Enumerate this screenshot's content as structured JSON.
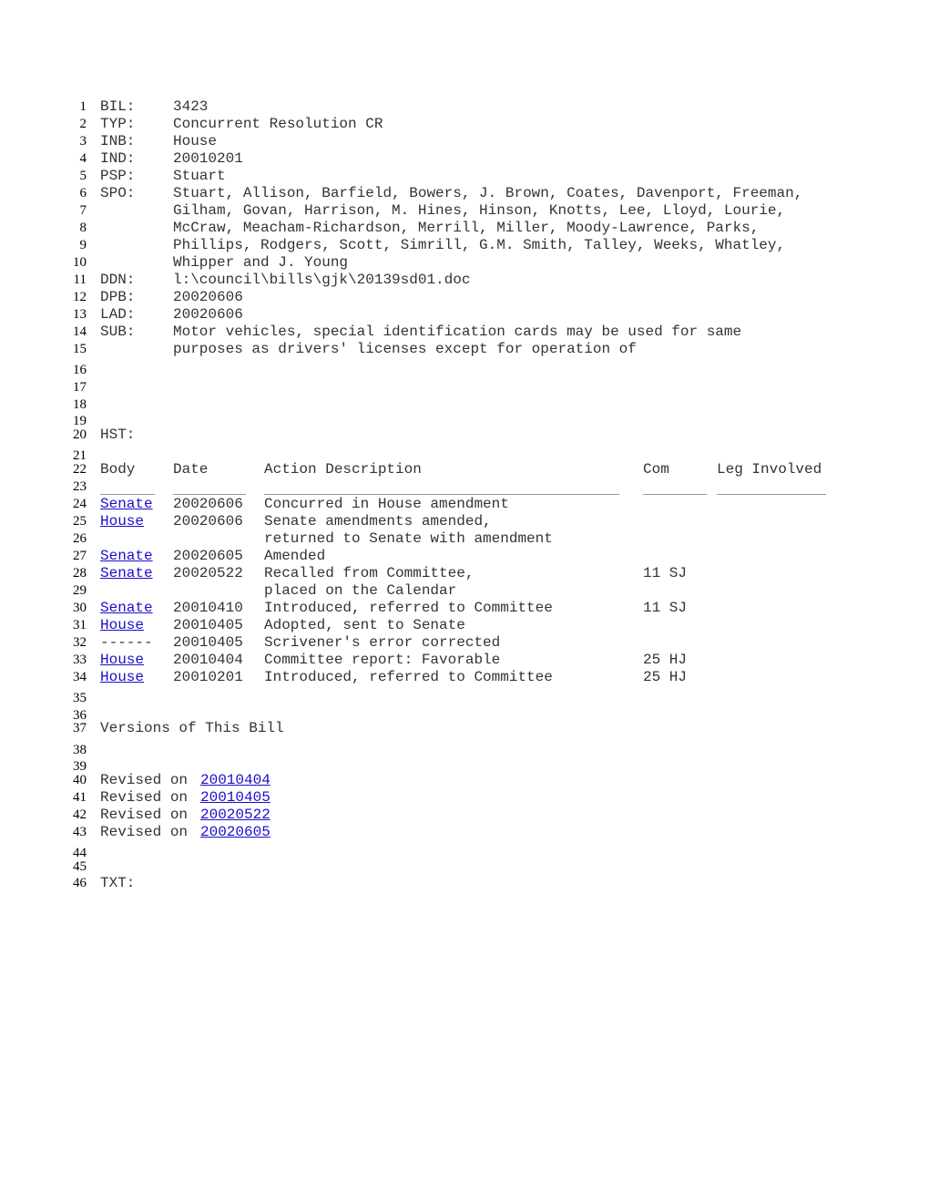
{
  "header": {
    "fields": [
      {
        "line": "1",
        "key": "BIL:",
        "value": "3423"
      },
      {
        "line": "2",
        "key": "TYP:",
        "value": "Concurrent Resolution CR"
      },
      {
        "line": "3",
        "key": "INB:",
        "value": "House"
      },
      {
        "line": "4",
        "key": "IND:",
        "value": "20010201"
      },
      {
        "line": "5",
        "key": "PSP:",
        "value": "Stuart"
      },
      {
        "line": "6",
        "key": "SPO:",
        "value": "Stuart, Allison, Barfield, Bowers, J. Brown, Coates, Davenport, Freeman,"
      },
      {
        "line": "7",
        "key": "",
        "value": "Gilham, Govan, Harrison, M. Hines, Hinson, Knotts, Lee, Lloyd, Lourie,"
      },
      {
        "line": "8",
        "key": "",
        "value": "McCraw, Meacham-Richardson, Merrill, Miller, Moody-Lawrence, Parks,"
      },
      {
        "line": "9",
        "key": "",
        "value": "Phillips, Rodgers, Scott, Simrill, G.M. Smith, Talley, Weeks, Whatley,"
      },
      {
        "line": "10",
        "key": "",
        "value": "Whipper and J. Young"
      },
      {
        "line": "11",
        "key": "DDN:",
        "value": "l:\\council\\bills\\gjk\\20139sd01.doc"
      },
      {
        "line": "12",
        "key": "DPB:",
        "value": "20020606"
      },
      {
        "line": "13",
        "key": "LAD:",
        "value": "20020606"
      },
      {
        "line": "14",
        "key": "SUB:",
        "value": "Motor vehicles, special identification cards may be used for same"
      },
      {
        "line": "15",
        "key": "",
        "value": "purposes as drivers' licenses except for operation of"
      }
    ]
  },
  "blank_lines": {
    "l16": "16",
    "l17": "17",
    "l18": "18",
    "l19": "19",
    "l21": "21",
    "l23": "23",
    "l35": "35",
    "l36": "36",
    "l38": "38",
    "l39": "39",
    "l44": "44",
    "l45": "45"
  },
  "history": {
    "line": "20",
    "label": "HST:",
    "header_line": "22",
    "columns": {
      "body": "Body",
      "date": "Date",
      "action": "Action Description",
      "com": "Com",
      "leg": "Leg Involved"
    },
    "rows": [
      {
        "line": "24",
        "body": "Senate",
        "body_link": true,
        "date": "20020606",
        "action": "Concurred in House amendment",
        "com": ""
      },
      {
        "line": "25",
        "body": "House",
        "body_link": true,
        "date": "20020606",
        "action": "Senate amendments amended,",
        "com": ""
      },
      {
        "line": "26",
        "body": "",
        "body_link": false,
        "date": "",
        "action": "returned to Senate with amendment",
        "com": ""
      },
      {
        "line": "27",
        "body": "Senate",
        "body_link": true,
        "date": "20020605",
        "action": "Amended",
        "com": ""
      },
      {
        "line": "28",
        "body": "Senate",
        "body_link": true,
        "date": "20020522",
        "action": "Recalled from Committee,",
        "com": "11 SJ"
      },
      {
        "line": "29",
        "body": "",
        "body_link": false,
        "date": "",
        "action": "placed on the Calendar",
        "com": ""
      },
      {
        "line": "30",
        "body": "Senate",
        "body_link": true,
        "date": "20010410",
        "action": "Introduced, referred to Committee",
        "com": "11 SJ"
      },
      {
        "line": "31",
        "body": "House",
        "body_link": true,
        "date": "20010405",
        "action": "Adopted, sent to Senate",
        "com": ""
      },
      {
        "line": "32",
        "body": "------",
        "body_link": false,
        "date": "20010405",
        "action": "Scrivener's error corrected",
        "com": ""
      },
      {
        "line": "33",
        "body": "House",
        "body_link": true,
        "date": "20010404",
        "action": "Committee report: Favorable",
        "com": "25 HJ"
      },
      {
        "line": "34",
        "body": "House",
        "body_link": true,
        "date": "20010201",
        "action": "Introduced, referred to Committee",
        "com": "25 HJ"
      }
    ]
  },
  "versions": {
    "line": "37",
    "title": "Versions of This Bill",
    "items": [
      {
        "line": "40",
        "prefix": "Revised on ",
        "date": "20010404"
      },
      {
        "line": "41",
        "prefix": "Revised on ",
        "date": "20010405"
      },
      {
        "line": "42",
        "prefix": "Revised on ",
        "date": "20020522"
      },
      {
        "line": "43",
        "prefix": "Revised on ",
        "date": "20020605"
      }
    ]
  },
  "text_section": {
    "line": "46",
    "label": "TXT:"
  },
  "colors": {
    "link": "#1a0dcc",
    "text": "#333333",
    "rule": "#999999"
  }
}
